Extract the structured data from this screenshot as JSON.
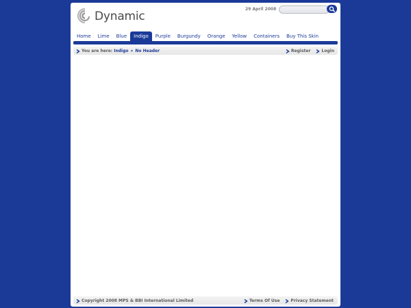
{
  "header": {
    "logo_text": "Dynamic",
    "date": "29 April 2008"
  },
  "search": {
    "value": "",
    "placeholder": ""
  },
  "nav": {
    "items": [
      {
        "label": "Home"
      },
      {
        "label": "Lime"
      },
      {
        "label": "Blue"
      },
      {
        "label": "Indigo"
      },
      {
        "label": "Purple"
      },
      {
        "label": "Burgundy"
      },
      {
        "label": "Orange"
      },
      {
        "label": "Yellow"
      },
      {
        "label": "Containers"
      },
      {
        "label": "Buy This Skin"
      }
    ],
    "active": "Indigo"
  },
  "breadcrumb": {
    "prefix": "You are here:",
    "crumb1": "Indigo",
    "separator": "»",
    "crumb2": "No Header"
  },
  "user_links": {
    "register": "Register",
    "login": "Login"
  },
  "footer": {
    "copyright": "Copyright 2008 MPS & BBI International Limited",
    "terms": "Terms Of Use",
    "privacy": "Privacy Statement"
  },
  "colors": {
    "brand": "#1b3a98",
    "background": "#1b3a98",
    "page": "#ffffff"
  },
  "icons": [
    "dynamic-logo-icon",
    "search-icon",
    "arrow-right-icon"
  ]
}
